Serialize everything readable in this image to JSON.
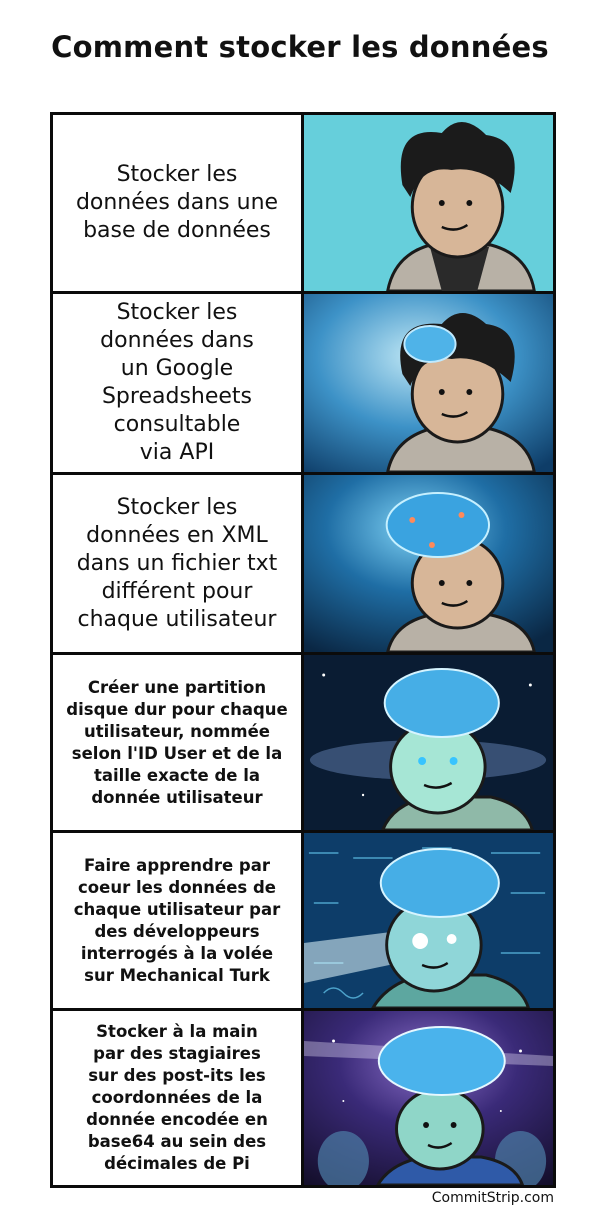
{
  "title": "Comment stocker les données",
  "panels": [
    {
      "caption": "Stocker les\ndonnées dans une\nbase de données",
      "background": "#66cfdb"
    },
    {
      "caption": "Stocker les\ndonnées dans\nun Google\nSpreadsheets\nconsultable\nvia API",
      "background": "#2f86b9"
    },
    {
      "caption": "Stocker les\ndonnées en XML\ndans un fichier txt\ndifférent pour\nchaque utilisateur",
      "background": "#123c63"
    },
    {
      "caption": "Créer une partition\ndisque dur pour chaque\nutilisateur, nommée\nselon l'ID User et de la\ntaille exacte de la\ndonnée utilisateur",
      "background": "#0a1c33"
    },
    {
      "caption": "Faire apprendre par\ncoeur les données de\nchaque utilisateur par\ndes développeurs\ninterrogés à la volée\nsur Mechanical Turk",
      "background": "#0d3d69"
    },
    {
      "caption": "Stocker à la main\npar des stagiaires\nsur des post-its les\ncoordonnées de la\ndonnée encodée en\nbase64 au sein des\ndécimales de Pi",
      "background": "#1a1438"
    }
  ],
  "credit": "CommitStrip.com"
}
